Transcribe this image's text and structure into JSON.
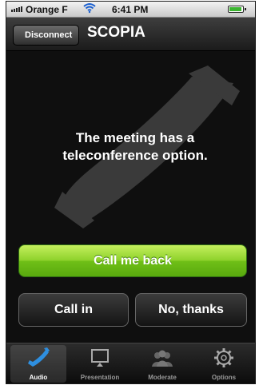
{
  "status_bar": {
    "carrier": "Orange F",
    "time": "6:41 PM"
  },
  "nav": {
    "back_label": "Disconnect",
    "title": "SCOPIA"
  },
  "main": {
    "message_line1": "The meeting has a",
    "message_line2": "teleconference option.",
    "call_me_back_label": "Call me back",
    "call_in_label": "Call in",
    "no_thanks_label": "No, thanks"
  },
  "tabs": [
    {
      "label": "Audio",
      "icon": "phone-icon",
      "active": true
    },
    {
      "label": "Presentation",
      "icon": "monitor-icon",
      "active": false
    },
    {
      "label": "Moderate",
      "icon": "people-icon",
      "active": false
    },
    {
      "label": "Options",
      "icon": "gear-icon",
      "active": false
    }
  ],
  "colors": {
    "accent_green": "#8fd22c",
    "active_tab_icon": "#2e8fe0"
  }
}
